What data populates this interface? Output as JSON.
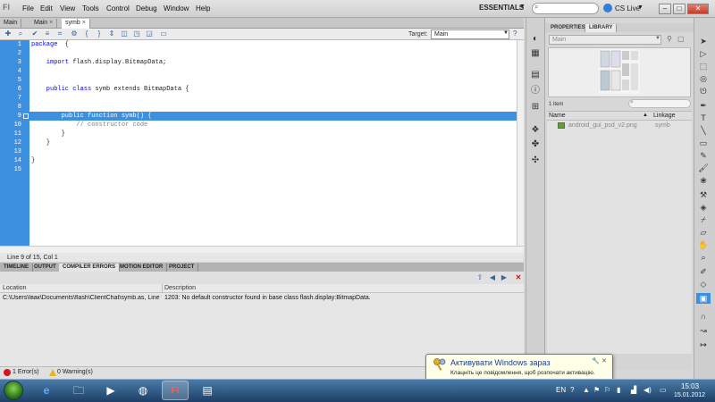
{
  "app": {
    "logo": "Fl",
    "menu": [
      "File",
      "Edit",
      "View",
      "Tools",
      "Control",
      "Debug",
      "Window",
      "Help"
    ],
    "workspace": "ESSENTIALS",
    "search_placeholder": "",
    "cslive": "CS Live"
  },
  "doc_tabs": [
    {
      "label": "Main"
    },
    {
      "label": "Main",
      "close": "×"
    },
    {
      "label": "symb",
      "close": "×"
    }
  ],
  "toolbar": {
    "target_label": "Target:",
    "target_value": "Main"
  },
  "editor": {
    "line_numbers": [
      "1",
      "2",
      "3",
      "4",
      "5",
      "6",
      "7",
      "8",
      "9",
      "10",
      "11",
      "12",
      "13",
      "14",
      "15"
    ],
    "lines": [
      {
        "kw": "package",
        "rest": "  {"
      },
      {
        "kw": "",
        "rest": ""
      },
      {
        "kw": "    import",
        "rest": " flash.display.BitmapData;"
      },
      {
        "kw": "",
        "rest": ""
      },
      {
        "kw": "",
        "rest": ""
      },
      {
        "kw": "    public class",
        "rest": " symb extends BitmapData {"
      },
      {
        "kw": "",
        "rest": ""
      },
      {
        "kw": "",
        "rest": ""
      },
      {
        "kw": "        public function",
        "rest": " symb() {"
      },
      {
        "kw": "",
        "rest": "            // constructor code"
      },
      {
        "kw": "",
        "rest": "        }"
      },
      {
        "kw": "",
        "rest": "    }"
      },
      {
        "kw": "",
        "rest": ""
      },
      {
        "kw": "",
        "rest": "}"
      },
      {
        "kw": "",
        "rest": ""
      }
    ],
    "status": "Line 9 of 15, Col 1"
  },
  "bottom_panel": {
    "tabs": [
      "TIMELINE",
      "OUTPUT",
      "COMPILER ERRORS",
      "MOTION EDITOR",
      "PROJECT"
    ],
    "columns": [
      "Location",
      "Description"
    ],
    "error_location": "C:\\Users\\Івак\\Documents\\flash\\ClientChat\\symb.as, Line 9",
    "error_description": "1203: No default constructor found in base class flash.display:BitmapData.",
    "error_count": "1 Error(s)",
    "warning_count": "0 Warning(s)"
  },
  "library": {
    "tabs": [
      "PROPERTIES",
      "LIBRARY"
    ],
    "select_value": "Main",
    "item_count": "1 item",
    "columns": [
      "Name",
      "Linkage"
    ],
    "items": [
      {
        "name": "android_gui_psd_v2.png",
        "linkage": "symb"
      }
    ]
  },
  "notification": {
    "title": "Активувати Windows зараз",
    "text": "Клацніть це повідомлення, щоб розпочати активацію."
  },
  "taskbar": {
    "lang": "EN",
    "time": "15:03",
    "date": "15.01.2012"
  }
}
